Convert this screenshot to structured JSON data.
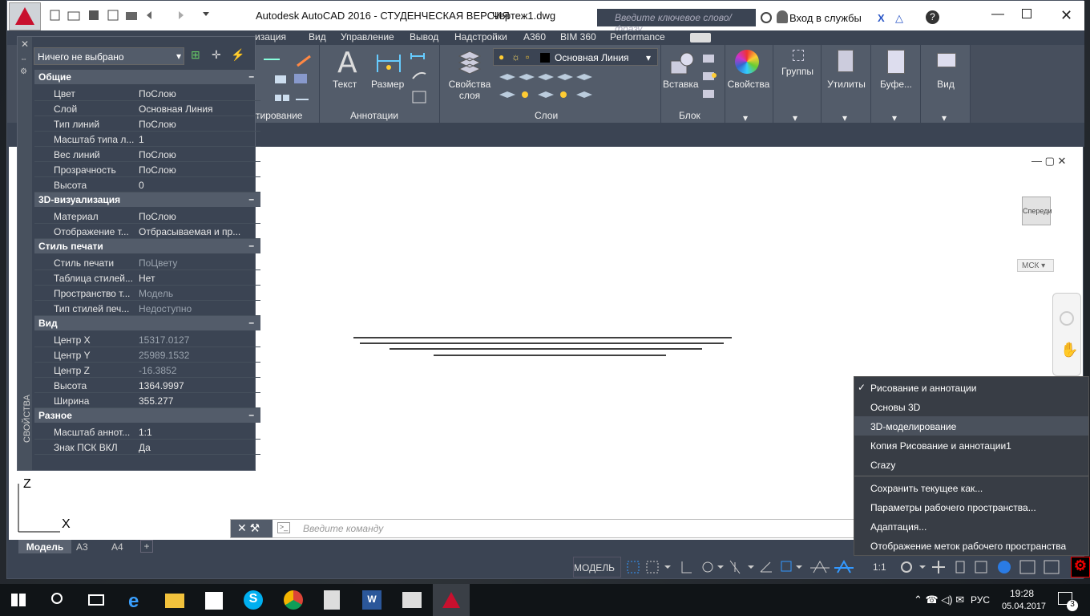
{
  "window": {
    "app_title": "Autodesk AutoCAD 2016 - СТУДЕНЧЕСКАЯ ВЕРСИЯ",
    "file": "Чертеж1.dwg",
    "search_placeholder": "Введите ключевое слово/фразу",
    "signin": "Вход в службы",
    "help": "?"
  },
  "menu": [
    "изация",
    "Вид",
    "Управление",
    "Вывод",
    "Надстройки",
    "A360",
    "BIM 360",
    "Performance"
  ],
  "ribbon": {
    "text": "Текст",
    "dim": "Размер",
    "annotations": "Аннотации",
    "layer_props_1": "Свойства",
    "layer_props_2": "слоя",
    "layer_name": "Основная Линия",
    "layers": "Слои",
    "insert": "Вставка",
    "block": "Блок",
    "properties": "Свойства",
    "groups": "Группы",
    "utilities": "Утилиты",
    "clipboard": "Буфе...",
    "view": "Вид",
    "modify": "тирование"
  },
  "properties_palette": {
    "selection": "Ничего не выбрано",
    "sections": [
      {
        "title": "Общие",
        "rows": [
          [
            "Цвет",
            "ПоСлою"
          ],
          [
            "Слой",
            "Основная Линия"
          ],
          [
            "Тип линий",
            "ПоСлою"
          ],
          [
            "Масштаб типа л...",
            "1"
          ],
          [
            "Вес линий",
            "ПоСлою"
          ],
          [
            "Прозрачность",
            "ПоСлою"
          ],
          [
            "Высота",
            "0"
          ]
        ]
      },
      {
        "title": "3D-визуализация",
        "rows": [
          [
            "Материал",
            "ПоСлою"
          ],
          [
            "Отображение т...",
            "Отбрасываемая и пр..."
          ]
        ]
      },
      {
        "title": "Стиль печати",
        "rows": [
          [
            "Стиль печати",
            "ПоЦвету"
          ],
          [
            "Таблица стилей...",
            "Нет"
          ],
          [
            "Пространство т...",
            "Модель"
          ],
          [
            "Тип стилей печ...",
            "Недоступно"
          ]
        ]
      },
      {
        "title": "Вид",
        "rows": [
          [
            "Центр X",
            "15317.0127"
          ],
          [
            "Центр Y",
            "25989.1532"
          ],
          [
            "Центр Z",
            "-16.3852"
          ],
          [
            "Высота",
            "1364.9997"
          ],
          [
            "Ширина",
            "355.277"
          ]
        ]
      },
      {
        "title": "Разное",
        "rows": [
          [
            "Масштаб аннот...",
            "1:1"
          ],
          [
            "Знак ПСК ВКЛ",
            "Да"
          ]
        ]
      }
    ],
    "side_label": "СВОЙСТВА"
  },
  "viewcube": {
    "face": "Спереди",
    "ucs": "МСК"
  },
  "ucs_icon": {
    "z": "Z",
    "x": "X"
  },
  "command_line": {
    "placeholder": "Введите команду"
  },
  "layout_tabs": [
    "Модель",
    "A3",
    "A4",
    "+"
  ],
  "statusbar": {
    "model": "МОДЕЛЬ",
    "scale": "1:1"
  },
  "workspace_menu": {
    "items": [
      "Рисование и аннотации",
      "Основы 3D",
      "3D-моделирование",
      "Копия Рисование и аннотации1",
      "Crazy",
      "Сохранить текущее как...",
      "Параметры рабочего пространства...",
      "Адаптация...",
      "Отображение меток рабочего пространства"
    ],
    "checked": "✓"
  },
  "taskbar": {
    "lang": "РУС",
    "time": "19:28",
    "date": "05.04.2017",
    "notif": "3"
  }
}
